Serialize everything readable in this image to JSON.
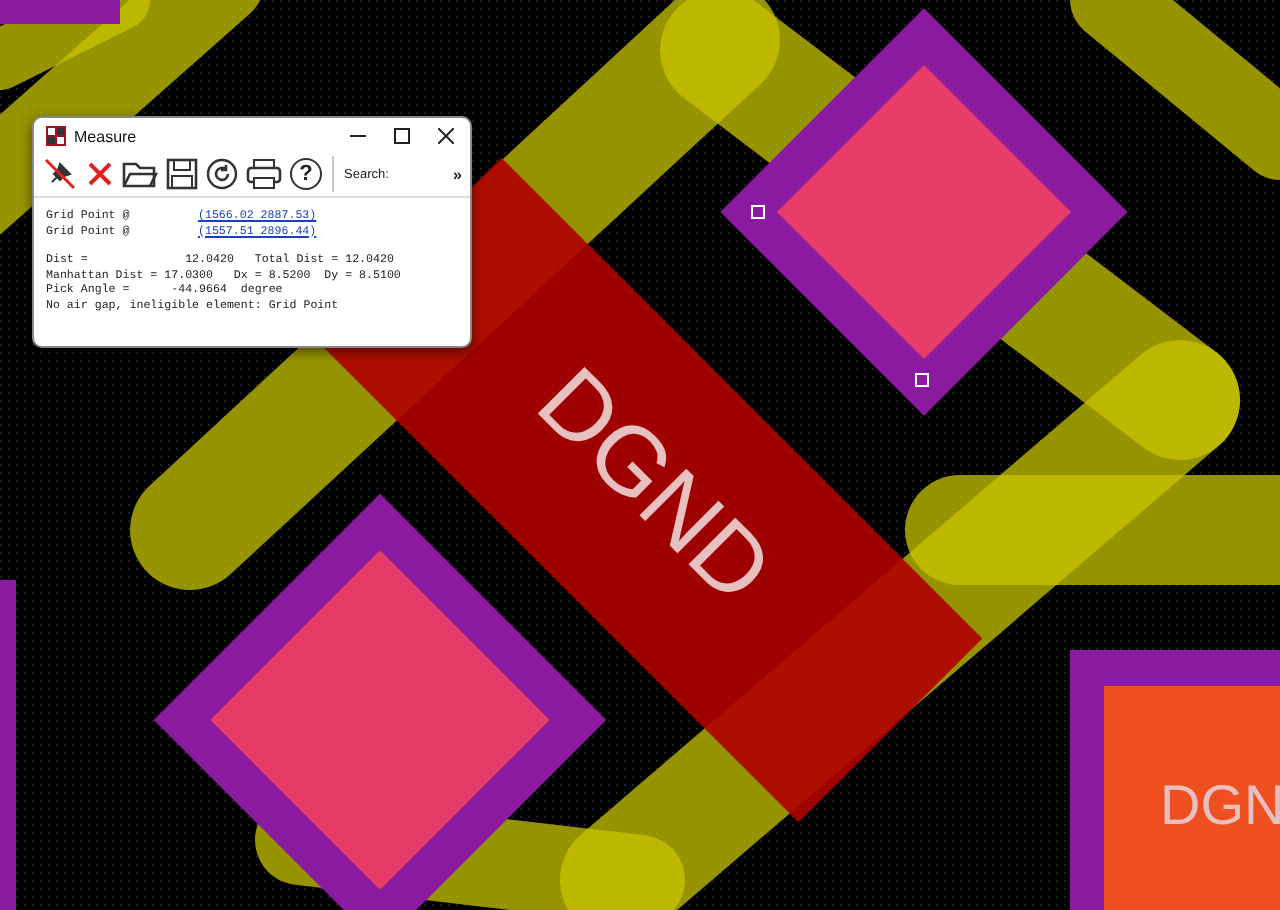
{
  "canvas": {
    "labels": [
      "DGND",
      "DGN"
    ]
  },
  "window": {
    "title": "Measure"
  },
  "toolbar": {
    "search_label": "Search:",
    "overflow": "»",
    "help_glyph": "?"
  },
  "points": [
    {
      "label": "Grid Point @",
      "coords": "(1566.02 2887.53)"
    },
    {
      "label": "Grid Point @",
      "coords": "(1557.51 2896.44)"
    }
  ],
  "results": [
    "Dist =              12.0420   Total Dist = 12.0420",
    "Manhattan Dist = 17.0300   Dx = 8.5200  Dy = 8.5100",
    "Pick Angle =      -44.9664  degree",
    "No air gap, ineligible element: Grid Point"
  ]
}
